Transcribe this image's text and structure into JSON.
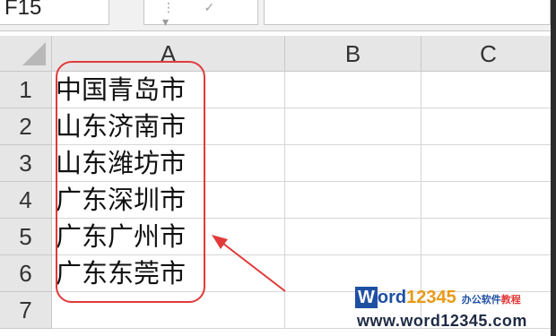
{
  "formula_bar": {
    "name_box": "F15"
  },
  "columns": [
    "A",
    "B",
    "C"
  ],
  "rows": [
    {
      "num": "1",
      "A": "中国青岛市"
    },
    {
      "num": "2",
      "A": "山东济南市"
    },
    {
      "num": "3",
      "A": "山东潍坊市"
    },
    {
      "num": "4",
      "A": "广东深圳市"
    },
    {
      "num": "5",
      "A": "广东广州市"
    },
    {
      "num": "6",
      "A": "广东东莞市"
    },
    {
      "num": "7",
      "A": ""
    }
  ],
  "watermark": {
    "brand_w": "W",
    "brand_ord": "ord",
    "brand_num": "12345",
    "tagline": "办公软件",
    "tagline_red": "教程",
    "url": "www.word12345.com"
  },
  "annotation_color": "#e23a3a"
}
